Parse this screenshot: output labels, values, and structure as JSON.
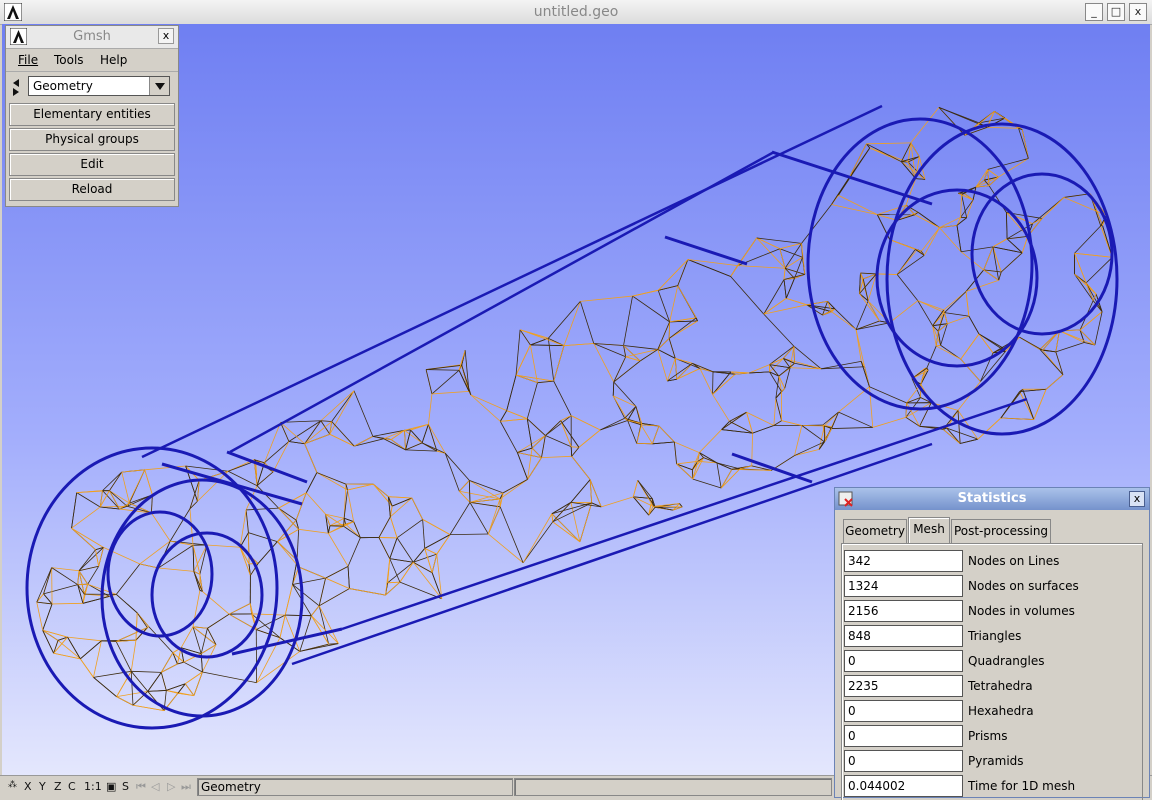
{
  "window": {
    "title": "untitled.geo",
    "minimize": "_",
    "maximize": "□",
    "close": "x"
  },
  "menu_panel": {
    "title": "Gmsh",
    "close": "x",
    "menus": [
      "File",
      "Tools",
      "Help"
    ],
    "module_select": "Geometry",
    "buttons": [
      "Elementary entities",
      "Physical groups",
      "Edit",
      "Reload"
    ]
  },
  "statusbar": {
    "icons": [
      "X",
      "Y",
      "Z",
      "C",
      "1:1",
      "S"
    ],
    "message": "Geometry",
    "message2": ""
  },
  "statistics": {
    "title": "Statistics",
    "close": "x",
    "tabs": [
      "Geometry",
      "Mesh",
      "Post-processing"
    ],
    "active_tab": "Mesh",
    "rows": [
      {
        "value": "342",
        "label": "Nodes on Lines"
      },
      {
        "value": "1324",
        "label": "Nodes on surfaces"
      },
      {
        "value": "2156",
        "label": "Nodes in volumes"
      },
      {
        "value": "848",
        "label": "Triangles"
      },
      {
        "value": "0",
        "label": "Quadrangles"
      },
      {
        "value": "2235",
        "label": "Tetrahedra"
      },
      {
        "value": "0",
        "label": "Hexahedra"
      },
      {
        "value": "0",
        "label": "Prisms"
      },
      {
        "value": "0",
        "label": "Pyramids"
      },
      {
        "value": "0.044002",
        "label": "Time for 1D mesh"
      }
    ]
  },
  "colors": {
    "geometry_lines": "#1a1ab4",
    "mesh_light": "#f0a020",
    "mesh_dark": "#3a2a10"
  }
}
